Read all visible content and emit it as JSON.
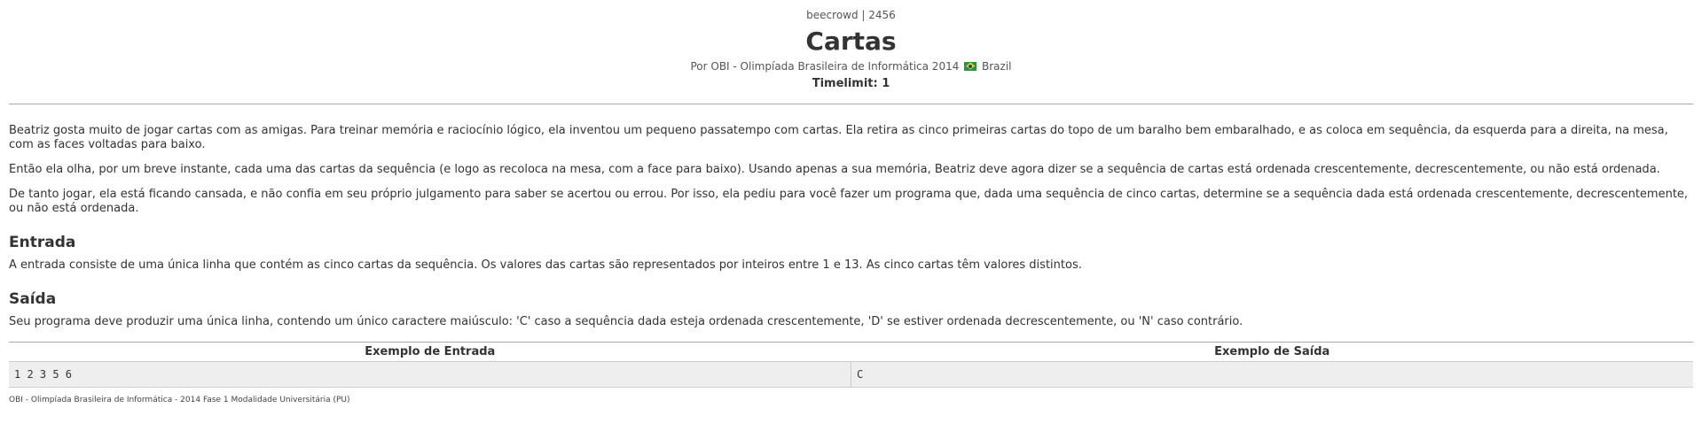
{
  "header": {
    "judge_id": "beecrowd | 2456",
    "title": "Cartas",
    "author_prefix": "Por OBI - Olimpíada Brasileira de Informática 2014",
    "country": "Brazil",
    "flag_icon": "brazil-flag-icon",
    "timelimit": "Timelimit: 1"
  },
  "description": {
    "paragraphs": [
      "Beatriz gosta muito de jogar cartas com as amigas. Para treinar memória e raciocínio lógico, ela inventou um pequeno passatempo com cartas. Ela retira as cinco primeiras cartas do topo de um baralho bem embaralhado, e as coloca em sequência, da esquerda para a direita, na mesa, com as faces voltadas para baixo.",
      "Então ela olha, por um breve instante, cada uma das cartas da sequência (e logo as recoloca na mesa, com a face para baixo). Usando apenas a sua memória, Beatriz deve agora dizer se a sequência de cartas está ordenada crescentemente, decrescentemente, ou não está ordenada.",
      "De tanto jogar, ela está ficando cansada, e não confia em seu próprio julgamento para saber se acertou ou errou. Por isso, ela pediu para você fazer um programa que, dada uma sequência de cinco cartas, determine se a sequência dada está ordenada crescentemente, decrescentemente, ou não está ordenada."
    ]
  },
  "input_section": {
    "heading": "Entrada",
    "text": "A entrada consiste de uma única linha que contém as cinco cartas da sequência. Os valores das cartas são representados por inteiros entre 1 e 13. As cinco cartas têm valores distintos."
  },
  "output_section": {
    "heading": "Saída",
    "text": "Seu programa deve produzir uma única linha, contendo um único caractere maiúsculo: 'C' caso a sequência dada esteja ordenada crescentemente, 'D' se estiver ordenada decrescentemente, ou 'N' caso contrário."
  },
  "examples": {
    "input_header": "Exemplo de Entrada",
    "output_header": "Exemplo de Saída",
    "input_value": "1 2 3 5 6",
    "output_value": "C"
  },
  "footer": {
    "text": "OBI - Olimpíada Brasileira de Informática - 2014 Fase 1 Modalidade Universitária (PU)"
  }
}
